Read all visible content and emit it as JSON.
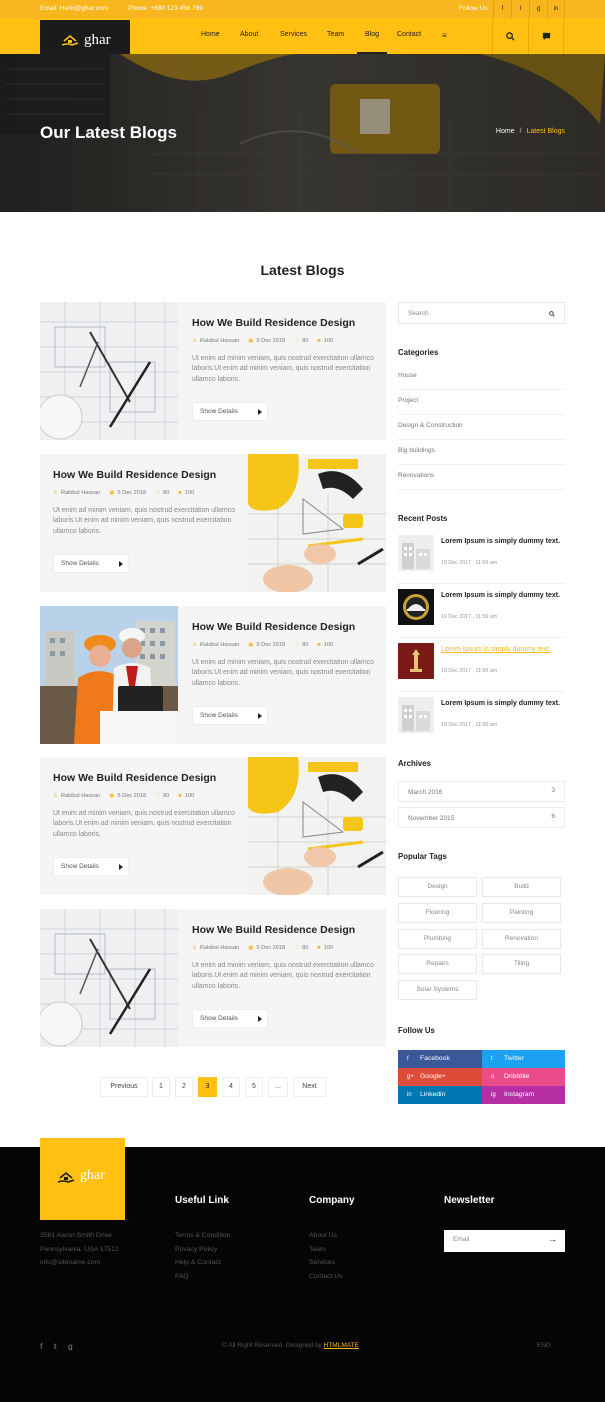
{
  "topbar": {
    "email": "Email: Hello@ghar.com",
    "phone": "Phone: +880 123 456 789",
    "follow": "Follow Us :",
    "social": [
      "f",
      "t",
      "g",
      "in"
    ]
  },
  "brand": {
    "name": "ghar"
  },
  "nav": {
    "items": [
      "Home",
      "About",
      "Services",
      "Team",
      "Blog",
      "Contact"
    ],
    "active": "Blog",
    "menu_icon": "menu-icon",
    "search_icon": "search-icon",
    "chat_icon": "chat-icon"
  },
  "hero": {
    "title": "Our Latest Blogs",
    "breadcrumb_home": "Home",
    "breadcrumb_sep": "/",
    "breadcrumb_current": "Latest Blogs"
  },
  "section": {
    "title": "Latest Blogs"
  },
  "posts": [
    {
      "title": "How We Build Residence Design",
      "author": "Rakibul Hassan",
      "date": "5 Dec 2018",
      "likes": "80",
      "comments": "100",
      "excerpt": "Ut enim ad minim veniam, quis nostrud exercitation ullamco laboris.Ut enim ad minim veniam, quis nostrud exercitation ullamco laboris.",
      "button": "Show Details"
    },
    {
      "title": "How We Build Residence Design",
      "author": "Rakibul Hassan",
      "date": "5 Dec 2018",
      "likes": "80",
      "comments": "100",
      "excerpt": "Ut enim ad minim veniam, quis nostrud exercitation ullamco laboris.Ut enim ad minim veniam, quis nostrud exercitation ullamco laboris.",
      "button": "Show Details"
    },
    {
      "title": "How We Build Residence Design",
      "author": "Rakibul Hassan",
      "date": "5 Dec 2018",
      "likes": "80",
      "comments": "100",
      "excerpt": "Ut enim ad minim veniam, quis nostrud exercitation ullamco laboris.Ut enim ad minim veniam, quis nostrud exercitation ullamco laboris.",
      "button": "Show Details"
    },
    {
      "title": "How We Build Residence Design",
      "author": "Rakibul Hassan",
      "date": "5 Dec 2018",
      "likes": "80",
      "comments": "100",
      "excerpt": "Ut enim ad minim veniam, quis nostrud exercitation ullamco laboris.Ut enim ad minim veniam, quis nostrud exercitation ullamco laboris.",
      "button": "Show Details"
    },
    {
      "title": "How We Build Residence Design",
      "author": "Rakibul Hassan",
      "date": "5 Dec 2018",
      "likes": "80",
      "comments": "100",
      "excerpt": "Ut enim ad minim veniam, quis nostrud exercitation ullamco laboris.Ut enim ad minim veniam, quis nostrud exercitation ullamco laboris.",
      "button": "Show Details"
    }
  ],
  "pagination": {
    "prev": "Previous",
    "pages": [
      "1",
      "2",
      "3",
      "4",
      "5",
      "..."
    ],
    "current": "3",
    "next": "Next"
  },
  "sidebar": {
    "search_placeholder": "Search",
    "categories_title": "Categories",
    "categories": [
      "House",
      "Project",
      "Design & Construction",
      "Big buildings",
      "Renovations"
    ],
    "recent_title": "Recent Posts",
    "recent": [
      {
        "title": "Lorem Ipsum is simply dummy text.",
        "date": "19 Dec 2017 , 11:56 am"
      },
      {
        "title": "Lorem Ipsum is simply dummy text.",
        "date": "19 Dec 2017 , 11:56 am"
      },
      {
        "title": "Lorem Ipsum is simply dummy text.",
        "date": "19 Dec 2017 , 11:56 am"
      },
      {
        "title": "Lorem Ipsum is simply dummy text.",
        "date": "19 Dec 2017 , 11:56 am"
      }
    ],
    "archives_title": "Archives",
    "archives": [
      {
        "label": "March 2016",
        "count": "3"
      },
      {
        "label": "November 2015",
        "count": "6"
      }
    ],
    "tags_title": "Popular Tags",
    "tags": [
      "Design",
      "Build",
      "Flooring",
      "Painting",
      "Plumbing",
      "Renovation",
      "Repairs",
      "Tiling",
      "Solar Systems"
    ],
    "follow_title": "Follow Us",
    "social": [
      {
        "label": "Facebook",
        "icon": "f",
        "color": "#3b5998"
      },
      {
        "label": "Twitter",
        "icon": "t",
        "color": "#1da1f2"
      },
      {
        "label": "Google+",
        "icon": "g+",
        "color": "#dd4b39"
      },
      {
        "label": "Dribbble",
        "icon": "o",
        "color": "#ea4c89"
      },
      {
        "label": "Linkedin",
        "icon": "in",
        "color": "#0077b5"
      },
      {
        "label": "Instagram",
        "icon": "ig",
        "color": "#b52ea3"
      }
    ]
  },
  "footer": {
    "address": [
      "3561 Aaron Smith Drive",
      "Pennsylvania, USA 17512",
      "info@sitename.com"
    ],
    "useful_title": "Useful Link",
    "useful": [
      "Terms & Condition",
      "Privacy Policy",
      "Help & Contact",
      "FAQ"
    ],
    "company_title": "Company",
    "company": [
      "About Us",
      "Team",
      "Services",
      "Contact Us"
    ],
    "newsletter_title": "Newsletter",
    "email_placeholder": "Email",
    "copyright": "© All Right Reserved. Designed by",
    "designer": "HTMLMATE",
    "lang": "ENG",
    "social": [
      "f",
      "t",
      "g"
    ]
  },
  "colors": {
    "accent": "#ffc012",
    "dark": "#050505"
  }
}
